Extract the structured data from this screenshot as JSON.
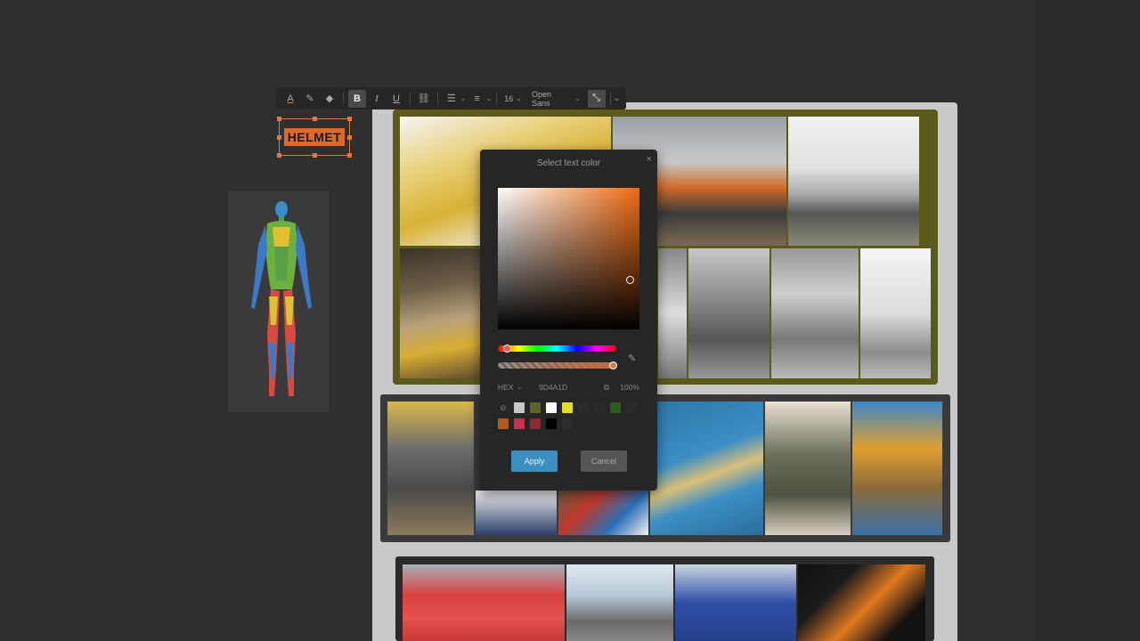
{
  "toolbar": {
    "font_size": "16",
    "font_family": "Open Sans",
    "text_color_label": "A",
    "bold_label": "B",
    "italic_label": "I",
    "underline_label": "U"
  },
  "canvas": {
    "helmet_text": "HELMET"
  },
  "color_picker": {
    "title": "Select text color",
    "close": "×",
    "format": "HEX",
    "hex_value": "9D4A1D",
    "opacity": "100%",
    "apply_label": "Apply",
    "cancel_label": "Cancel",
    "swatch_row1": [
      "#c9c9c9",
      "#5f6327",
      "#ffffff",
      "#e3e01d",
      "#2b2b2b",
      "#2a2a2a",
      "#2d5a1e",
      "#2b2b2b"
    ],
    "swatch_row2": [
      "#b8561f",
      "#c8304b",
      "#8e2a34",
      "#000000",
      "#2e2e2e"
    ],
    "selected_color": "#EF6A12"
  }
}
